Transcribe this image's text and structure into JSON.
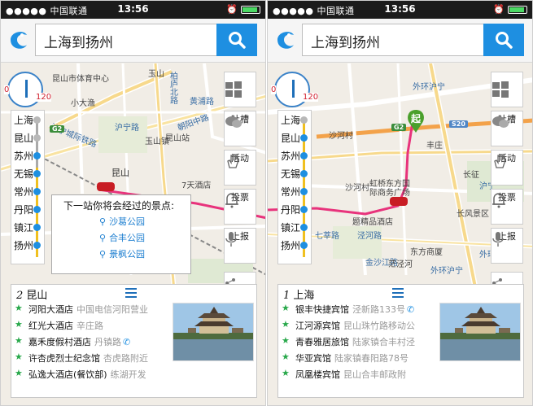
{
  "status_bar": {
    "carrier": "●●●●● 中国联通",
    "time": "13:56",
    "alarm": "⏰"
  },
  "search": {
    "query": "上海到扬州"
  },
  "compass": {
    "min": "0",
    "max": "120"
  },
  "stations": [
    "上海",
    "昆山",
    "苏州",
    "无锡",
    "常州",
    "丹阳",
    "镇江",
    "扬州"
  ],
  "tools": [
    "",
    "吐槽",
    "活动",
    "投票",
    "上报"
  ],
  "left": {
    "passed_count": 2,
    "popup": {
      "title": "下一站你将会经过的景点:",
      "items": [
        "沙葛公园",
        "合丰公园",
        "景枫公园"
      ]
    },
    "panel": {
      "index": "2",
      "city": "昆山",
      "hotels": [
        {
          "name": "河阳大酒店",
          "addr": "中国电信河阳营业",
          "phone": false
        },
        {
          "name": "红光大酒店",
          "addr": "辛庄路",
          "phone": false
        },
        {
          "name": "嘉禾度假村酒店",
          "addr": "丹镇路",
          "phone": true
        },
        {
          "name": "许杏虎烈士纪念馆",
          "addr": "杏虎路附近",
          "phone": false
        },
        {
          "name": "弘逸大酒店(餐饮部)",
          "addr": "练湖开发",
          "phone": false
        }
      ]
    },
    "map_labels": [
      "昆山市体育中心",
      "小大渔",
      "玉山",
      "柏庐北路",
      "黄浦路",
      "沪宁路",
      "朝阳中路",
      "玉山镇",
      "昆山站",
      "沪宁城际铁路",
      "7天酒店",
      "昆山"
    ],
    "shields": [
      "G2"
    ]
  },
  "right": {
    "passed_count": 0,
    "start_marker": "起",
    "panel": {
      "index": "1",
      "city": "上海",
      "hotels": [
        {
          "name": "银丰快捷宾馆",
          "addr": "泾新路133号",
          "phone": true
        },
        {
          "name": "江河源宾馆",
          "addr": "昆山珠竹路移动公",
          "phone": false
        },
        {
          "name": "青春雅居旅馆",
          "addr": "陆家镇合丰村泾",
          "phone": false
        },
        {
          "name": "华亚宾馆",
          "addr": "陆家镇春阳路78号",
          "phone": false
        },
        {
          "name": "凤凰楼宾馆",
          "addr": "昆山合丰邮政附",
          "phone": false
        }
      ]
    },
    "map_labels": [
      "外环沪宁",
      "沙河村",
      "丰庄",
      "长征",
      "沙河村",
      "虹桥东方国际商务广场",
      "长风景区",
      "题精品酒店",
      "七莘路",
      "泾河路",
      "东方商厦",
      "外环浦",
      "金沙江路",
      "沪宁",
      "茫泾河",
      "外环沪宁"
    ],
    "shields": [
      "G2",
      "G2",
      "S20"
    ]
  }
}
